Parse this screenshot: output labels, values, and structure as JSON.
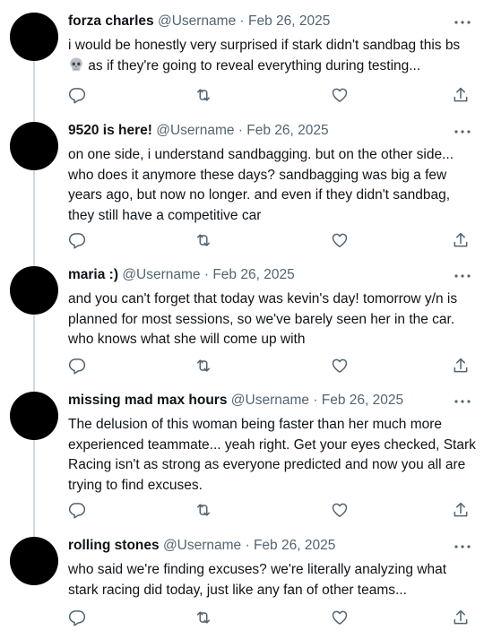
{
  "tweets": [
    {
      "name": "forza charles",
      "handle": "@Username",
      "separator": "·",
      "date": "Feb 26, 2025",
      "text_before_emoji": "i would be honestly very surprised if stark didn't sandbag this bs",
      "emoji": "skull-icon",
      "text_after_emoji": " as if they're going to reveal everything during testing..."
    },
    {
      "name": "9520 is here!",
      "handle": "@Username",
      "separator": "·",
      "date": "Feb 26, 2025",
      "text": "on one side, i understand sandbagging. but on the other side... who does it anymore these days? sandbagging was big a few years ago, but now no longer. and even if they didn't sandbag, they still have a competitive car"
    },
    {
      "name": "maria :)",
      "handle": "@Username",
      "separator": "·",
      "date": "Feb 26, 2025",
      "text": "and you can't forget that today was kevin's day! tomorrow y/n is planned for most sessions, so we've barely seen her in the car. who knows what she will come up with"
    },
    {
      "name": "missing mad max hours",
      "handle": "@Username",
      "separator": "·",
      "date": "Feb 26, 2025",
      "text": "The delusion of this woman being faster than her much more experienced teammate... yeah right. Get your eyes checked, Stark Racing isn't as strong as everyone predicted and now you all are trying to find excuses."
    },
    {
      "name": "rolling stones",
      "handle": "@Username",
      "separator": "·",
      "date": "Feb 26, 2025",
      "text": "who said we're finding excuses? we're literally analyzing what stark racing did today, just like any fan of other teams..."
    }
  ],
  "action_icons": [
    "reply-icon",
    "retweet-icon",
    "like-icon",
    "share-icon"
  ],
  "colors": {
    "text": "#0f1419",
    "secondary": "#536471",
    "thread_line": "#cfd9de",
    "avatar": "#000000"
  }
}
